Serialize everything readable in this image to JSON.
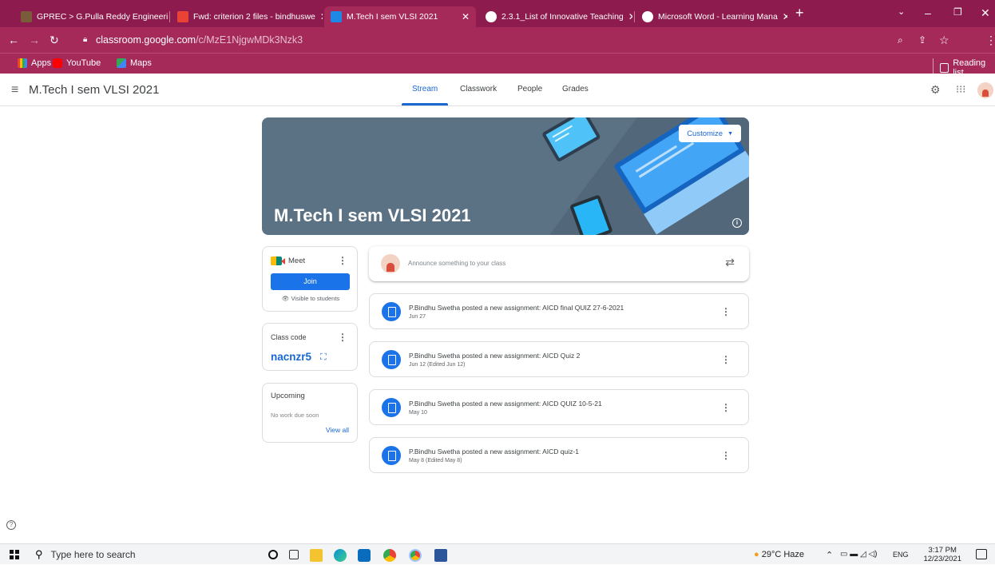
{
  "browser": {
    "tabs": [
      {
        "label": "GPREC > G.Pulla Reddy Engineeri",
        "fav": "#7a5c3a"
      },
      {
        "label": "Fwd: criterion 2 files - bindhuswe",
        "fav": "#ea4335"
      },
      {
        "label": "M.Tech I sem VLSI 2021",
        "fav": "#1e8e3e"
      },
      {
        "label": "2.3.1_List of Innovative Teaching",
        "fav": "#ffffff"
      },
      {
        "label": "Microsoft Word - Learning Mana",
        "fav": "#ffffff"
      }
    ],
    "url_domain": "classroom.google.com",
    "url_path": "/c/MzE1NjgwMDk3Nzk3",
    "bookmarks": [
      "Apps",
      "YouTube",
      "Maps"
    ],
    "reading_list": "Reading list"
  },
  "appbar": {
    "title": "M.Tech I sem VLSI 2021",
    "tabs": [
      "Stream",
      "Classwork",
      "People",
      "Grades"
    ],
    "active_tab": "Stream"
  },
  "banner": {
    "title": "M.Tech I sem VLSI 2021",
    "customize": "Customize"
  },
  "meet": {
    "label": "Meet",
    "join": "Join",
    "visibility": "Visible to students"
  },
  "class_code": {
    "label": "Class code",
    "code": "nacnzr5"
  },
  "upcoming": {
    "label": "Upcoming",
    "empty": "No work due soon",
    "view_all": "View all"
  },
  "announce": {
    "placeholder": "Announce something to your class"
  },
  "posts": [
    {
      "title": "P.Bindhu Swetha posted a new assignment: AICD final QUIZ 27-6-2021",
      "date": "Jun 27"
    },
    {
      "title": "P.Bindhu Swetha posted a new assignment: AICD Quiz 2",
      "date": "Jun 12 (Edited Jun 12)"
    },
    {
      "title": "P.Bindhu Swetha posted a new assignment: AICD QUIZ 10-5-21",
      "date": "May 10"
    },
    {
      "title": "P.Bindhu Swetha posted a new assignment: AICD quiz-1",
      "date": "May 8 (Edited May 8)"
    }
  ],
  "taskbar": {
    "search_placeholder": "Type here to search",
    "weather": "29°C Haze",
    "lang": "ENG",
    "time": "3:17 PM",
    "date": "12/23/2021"
  }
}
